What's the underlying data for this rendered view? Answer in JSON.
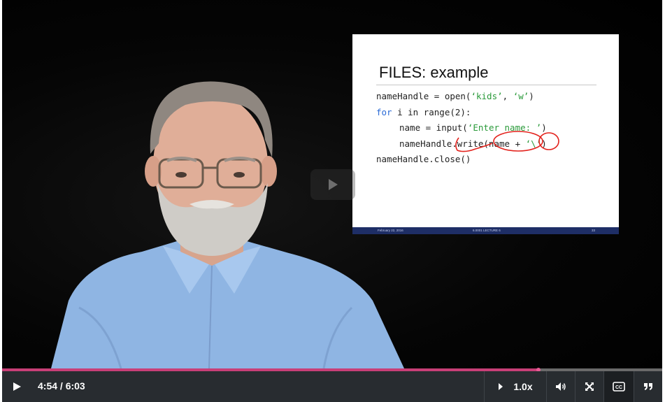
{
  "player": {
    "time_display": "4:54 / 6:03",
    "progress": 0.813,
    "speed_label": "1.0x",
    "accent_color": "#c83f77",
    "icons": {
      "play": "play-icon",
      "speed": "speed-arrow-icon",
      "volume": "volume-icon",
      "fullscreen": "fullscreen-icon",
      "captions": "closed-captions-icon",
      "transcript": "transcript-quote-icon"
    }
  },
  "slide": {
    "title": "FILES: example",
    "footer_left": "February 22, 2016",
    "footer_center": "6.0001 LECTURE 6",
    "footer_right": "33"
  }
}
